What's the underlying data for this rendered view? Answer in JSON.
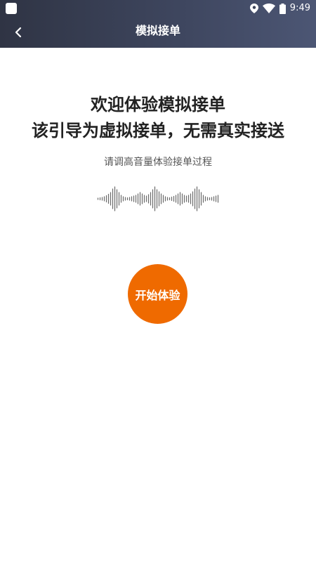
{
  "status_bar": {
    "time": "9:49",
    "icons": [
      "app-icon",
      "location-icon",
      "wifi-icon",
      "battery-icon"
    ]
  },
  "nav": {
    "title": "模拟接单",
    "back_icon": "chevron-left-icon"
  },
  "main": {
    "headline_line1": "欢迎体验模拟接单",
    "headline_line2": "该引导为虚拟接单，无需真实接送",
    "subtitle": "请调高音量体验接单过程",
    "waveform_icon": "sound-wave-icon",
    "start_button_label": "开始体验"
  },
  "colors": {
    "header_gradient_start": "#2f3444",
    "header_gradient_end": "#4c5674",
    "accent": "#ef6a00",
    "text_primary": "#222222",
    "text_secondary": "#555555"
  }
}
